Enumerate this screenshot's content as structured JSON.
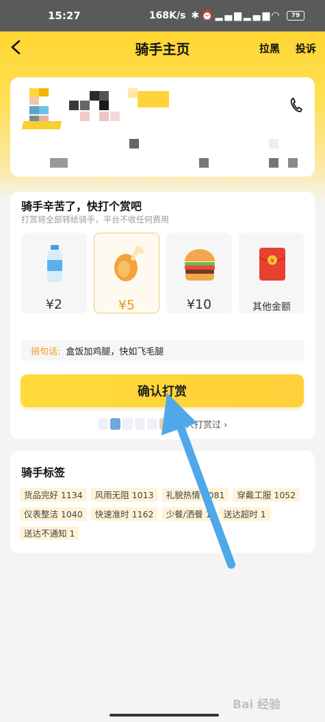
{
  "status_bar": {
    "time": "15:27",
    "network_speed": "168K/s",
    "battery_level": "79",
    "icons": [
      "bluetooth-icon",
      "alarm-icon",
      "signal-icon",
      "signal-icon",
      "wifi-icon",
      "battery-icon"
    ]
  },
  "nav": {
    "title": "骑手主页",
    "block_label": "拉黑",
    "report_label": "投诉"
  },
  "rider_card": {
    "phone_icon": "phone-icon"
  },
  "tip": {
    "title": "骑手辛苦了，快打个赏吧",
    "subtitle": "打赏将全部转给骑手，平台不收任何费用",
    "options": [
      {
        "label": "¥2",
        "icon": "water-bottle-icon"
      },
      {
        "label": "¥5",
        "icon": "chicken-leg-icon",
        "selected": true
      },
      {
        "label": "¥10",
        "icon": "burger-icon"
      },
      {
        "label": "其他金额",
        "icon": "red-envelope-icon"
      }
    ],
    "phrase_key": "捎句话:",
    "phrase_value": "盒饭加鸡腿，快如飞毛腿",
    "confirm_label": "确认打赏",
    "tippers_text": "人打赏过 ›"
  },
  "tags": {
    "title": "骑手标签",
    "items": [
      "货品完好 1134",
      "风雨无阻 1013",
      "礼貌热情 1081",
      "穿戴工服 1052",
      "仪表整洁 1040",
      "快速准时 1162",
      "少餐/洒餐 1",
      "送达超时 1",
      "送达不通知 1"
    ]
  },
  "watermark": "Bai 经验",
  "colors": {
    "accent_yellow": "#ffd631",
    "phrase_orange": "#f59a1c",
    "arrow_blue": "#4ea8ea"
  }
}
